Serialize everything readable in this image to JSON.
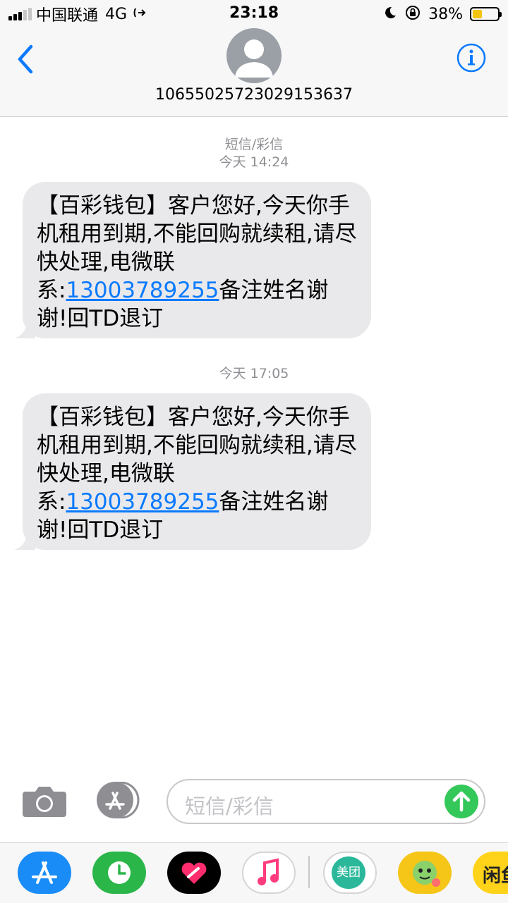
{
  "status_bar": {
    "carrier": "中国联通",
    "network": "4G",
    "time": "23:18",
    "battery_percent": "38%",
    "battery_level": 0.38,
    "battery_color": "#f5c40f",
    "icons": [
      "signal-icon",
      "call-forward-icon",
      "moon-icon",
      "orientation-lock-icon",
      "battery-icon"
    ]
  },
  "header": {
    "contact_number": "10655025723029153637",
    "back_icon": "chevron-left-icon",
    "info_icon": "info-icon"
  },
  "messages": [
    {
      "meta_label": "短信/彩信",
      "timestamp": "今天 14:24",
      "text_before": "【百彩钱包】客户您好,今天你手机租用到期,不能回购就续租,请尽快处理,电微联系:",
      "phone_link": "13003789255",
      "text_after": "备注姓名谢谢!回TD退订"
    },
    {
      "meta_label": "",
      "timestamp": "今天 17:05",
      "text_before": "【百彩钱包】客户您好,今天你手机租用到期,不能回购就续租,请尽快处理,电微联系:",
      "phone_link": "13003789255",
      "text_after": "备注姓名谢谢!回TD退订"
    }
  ],
  "input_bar": {
    "placeholder": "短信/彩信",
    "camera_icon": "camera-icon",
    "apps_icon": "app-store-icon",
    "send_icon": "send-arrow-icon"
  },
  "app_drawer": {
    "apps": [
      "App Store",
      "Activity",
      "Digital Touch",
      "Music",
      "美团",
      "Sticker",
      "闲鱼"
    ],
    "meituan_label": "美团",
    "partial_app_label": "闲鱼"
  },
  "colors": {
    "accent_blue": "#0a7aff",
    "bubble_gray": "#e9e9eb",
    "send_green": "#34c759"
  }
}
